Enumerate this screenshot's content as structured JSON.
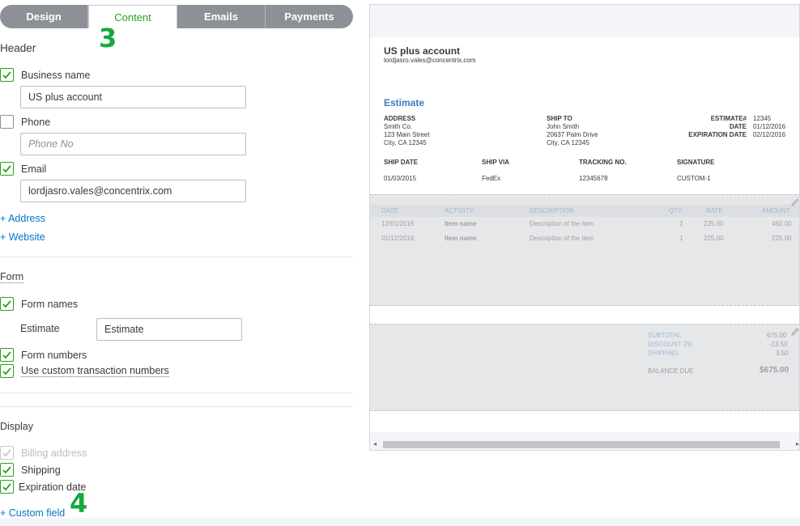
{
  "tabs": [
    {
      "label": "Design",
      "active": false
    },
    {
      "label": "Content",
      "active": true
    },
    {
      "label": "Emails",
      "active": false
    },
    {
      "label": "Payments",
      "active": false
    }
  ],
  "annotations": {
    "step3": "3",
    "step4": "4"
  },
  "header_section": {
    "title": "Header",
    "business_name": {
      "label": "Business name",
      "checked": true,
      "value": "US plus account"
    },
    "phone": {
      "label": "Phone",
      "checked": false,
      "placeholder": "Phone No"
    },
    "email": {
      "label": "Email",
      "checked": true,
      "value": "lordjasro.vales@concentrix.com"
    },
    "add_address": "+ Address",
    "add_website": "+ Website"
  },
  "form_section": {
    "title": "Form",
    "form_names": {
      "label": "Form names",
      "checked": true
    },
    "estimate_label": "Estimate",
    "estimate_value": "Estimate",
    "form_numbers": {
      "label": "Form numbers",
      "checked": true
    },
    "custom_numbers": {
      "label": "Use custom transaction numbers",
      "checked": true
    }
  },
  "display_section": {
    "title": "Display",
    "billing_address": {
      "label": "Billing address",
      "checked": true,
      "disabled": true
    },
    "shipping": {
      "label": "Shipping",
      "checked": true
    },
    "expiration_date": {
      "label": "Expiration date",
      "checked": true
    },
    "add_custom_field": "+ Custom field"
  },
  "preview": {
    "company": "US plus account",
    "company_email": "lordjasro.vales@concentrix.com",
    "doc_title": "Estimate",
    "address": {
      "heading": "ADDRESS",
      "lines": [
        "Smith Co.",
        "123 Main Street",
        "City, CA 12345"
      ]
    },
    "ship_to": {
      "heading": "SHIP TO",
      "lines": [
        "John Smith",
        "20637 Palm Drive",
        "City, CA 12345"
      ]
    },
    "meta": {
      "labels": [
        "ESTIMATE#",
        "DATE",
        "EXPIRATION DATE"
      ],
      "values": [
        "12345",
        "01/12/2016",
        "02/12/2016"
      ]
    },
    "ship": {
      "headings": [
        "SHIP DATE",
        "SHIP VIA",
        "TRACKING NO.",
        "SIGNATURE"
      ],
      "values": [
        "01/03/2015",
        "FedEx",
        "12345678",
        "CUSTOM-1"
      ]
    },
    "table": {
      "headers": [
        "DATE",
        "ACTIVITY",
        "DESCRIPTION",
        "QTY",
        "RATE",
        "AMOUNT"
      ],
      "rows": [
        [
          "12/01/2016",
          "Item name",
          "Description of the item",
          "2",
          "225.00",
          "450.00"
        ],
        [
          "01/12/2016",
          "Item name",
          "Description of the item",
          "1",
          "225.00",
          "225.00"
        ]
      ]
    },
    "summary": {
      "subtotal_label": "SUBTOTAL",
      "subtotal": "675.00",
      "discount_label": "DISCOUNT 2%",
      "discount": "-13.50",
      "shipping_label": "SHIPPING",
      "shipping": "3.50",
      "balance_label": "BALANCE DUE",
      "balance": "$675.00"
    }
  },
  "colors": {
    "accent_green": "#2ca01c",
    "link_blue": "#0077c5",
    "annotation_green": "#17a93f"
  }
}
